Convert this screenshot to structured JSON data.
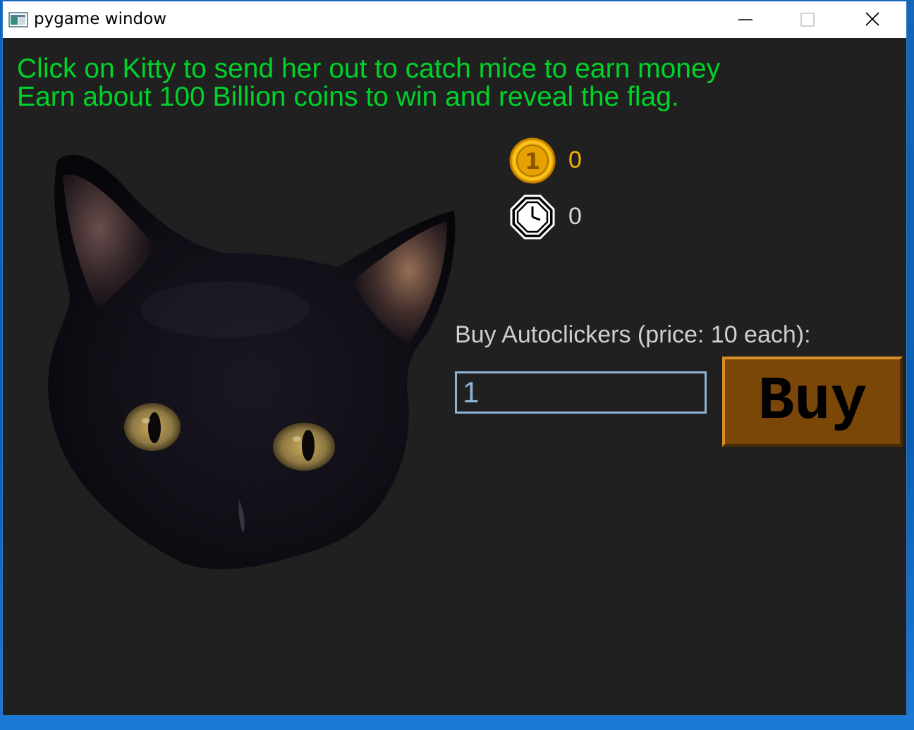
{
  "window": {
    "title": "pygame window",
    "minimize_icon": "minimize-icon",
    "maximize_icon": "maximize-icon",
    "close_icon": "close-icon"
  },
  "game": {
    "instructions_line1": "Click on Kitty to send her out to catch mice to earn money",
    "instructions_line2": "Earn about 100 Billion coins to win and reveal the flag.",
    "coins_icon": "coin-icon",
    "coins": "0",
    "timer_icon": "clock-icon",
    "timer": "0",
    "kitty_image": "black-cat-head",
    "shop": {
      "label": "Buy Autoclickers (price: 10 each):",
      "quantity_value": "1",
      "buy_button_label": "Buy"
    }
  },
  "colors": {
    "background": "#202020",
    "instructions": "#00d22a",
    "coins_text": "#f3b400",
    "timer_text": "#d8d8d8",
    "label_text": "#cfcfcf",
    "input_border": "#8fb3d2",
    "buy_button_fill": "#7a4708",
    "buy_button_highlight": "#d98e26"
  }
}
